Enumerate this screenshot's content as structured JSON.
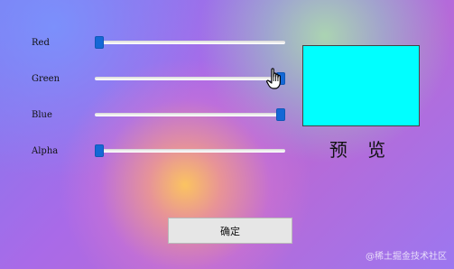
{
  "labels": {
    "red": "Red",
    "green": "Green",
    "blue": "Blue",
    "alpha": "Alpha"
  },
  "sliders": {
    "red_fraction": 0.0,
    "green_fraction": 1.0,
    "blue_fraction": 1.0,
    "alpha_fraction": 0.0
  },
  "colors": {
    "preview_fill": "#00ffff",
    "slider_thumb": "#1468d6"
  },
  "preview": {
    "label": "预 览"
  },
  "ok_button": {
    "label": "确定"
  },
  "watermark": "@稀土掘金技术社区",
  "icons": {
    "cursor": "hand-pointer-icon"
  }
}
